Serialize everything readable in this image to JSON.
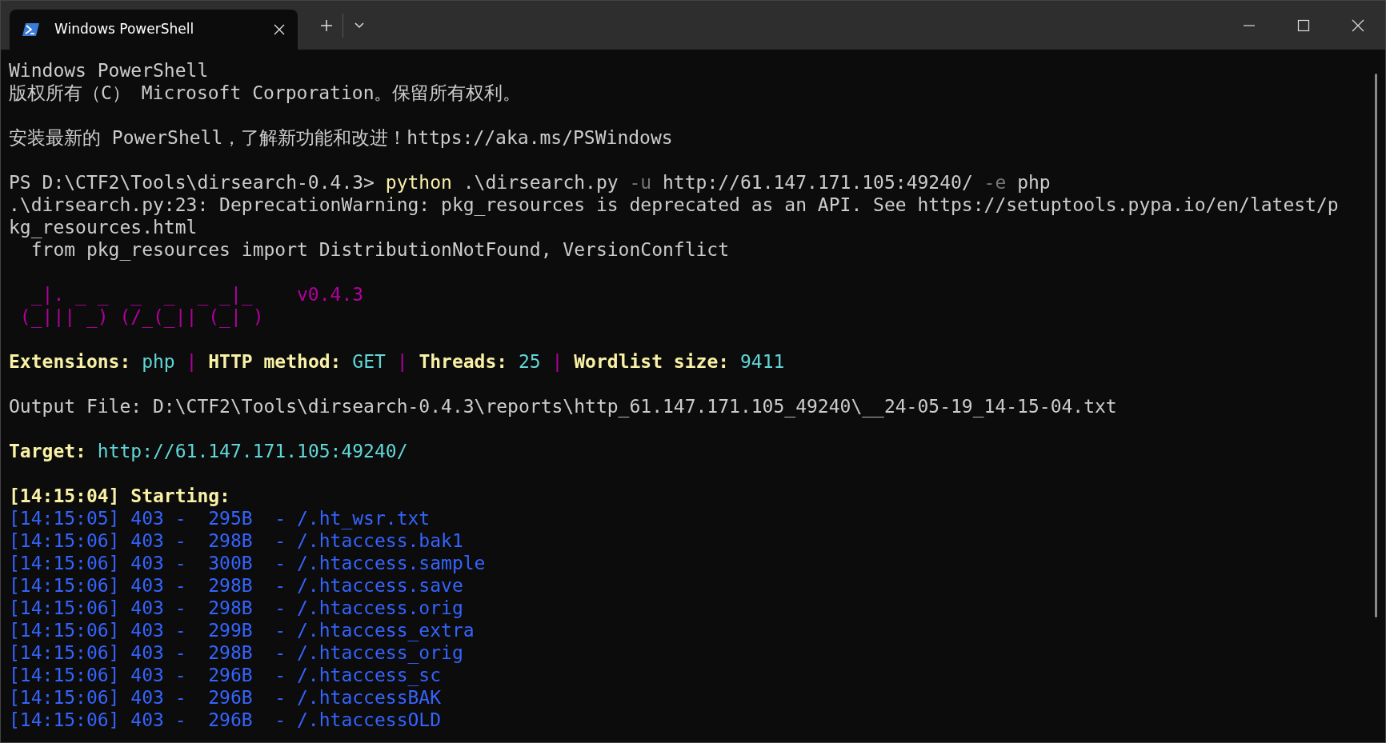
{
  "tabs": [
    {
      "title": "Windows PowerShell",
      "selected": true
    }
  ],
  "blocks": [
    [
      [
        {
          "kind": "plain",
          "text": "Windows PowerShell"
        }
      ],
      [
        {
          "kind": "plain",
          "text": "版权所有（C） Microsoft Corporation。保留所有权利。"
        }
      ]
    ],
    [
      [
        {
          "kind": "plain",
          "text": "安装最新的 PowerShell，了解新功能和改进！https://aka.ms/PSWindows"
        }
      ]
    ],
    [
      [
        {
          "kind": "plain",
          "text": "PS D:\\CTF2\\Tools\\dirsearch-0.4.3> "
        },
        {
          "kind": "command",
          "text": "python"
        },
        {
          "kind": "plain",
          "text": " .\\dirsearch.py "
        },
        {
          "kind": "flag",
          "text": "-u"
        },
        {
          "kind": "plain",
          "text": " http://61.147.171.105:49240/ "
        },
        {
          "kind": "flag",
          "text": "-e"
        },
        {
          "kind": "plain",
          "text": " php"
        }
      ],
      [
        {
          "kind": "plain",
          "text": ".\\dirsearch.py:23: DeprecationWarning: pkg_resources is deprecated as an API. See https://setuptools.pypa.io/en/latest/p"
        }
      ],
      [
        {
          "kind": "plain",
          "text": "kg_resources.html"
        }
      ],
      [
        {
          "kind": "plain",
          "text": "  from pkg_resources import DistributionNotFound, VersionConflict"
        }
      ]
    ],
    [
      [
        {
          "kind": "art",
          "text": "  _|. _ _  _  _  _ _|_    v0.4.3"
        }
      ],
      [
        {
          "kind": "art",
          "text": " (_||| _) (/_(_|| (_| )"
        }
      ]
    ],
    [
      [
        {
          "kind": "label",
          "text": "Extensions: "
        },
        {
          "kind": "value",
          "text": "php"
        },
        {
          "kind": "separator",
          "text": " | "
        },
        {
          "kind": "label",
          "text": "HTTP method: "
        },
        {
          "kind": "value",
          "text": "GET"
        },
        {
          "kind": "separator",
          "text": " | "
        },
        {
          "kind": "label",
          "text": "Threads: "
        },
        {
          "kind": "value",
          "text": "25"
        },
        {
          "kind": "separator",
          "text": " | "
        },
        {
          "kind": "label",
          "text": "Wordlist size: "
        },
        {
          "kind": "value",
          "text": "9411"
        }
      ]
    ],
    [
      [
        {
          "kind": "plain",
          "text": "Output File: D:\\CTF2\\Tools\\dirsearch-0.4.3\\reports\\http_61.147.171.105_49240\\__24-05-19_14-15-04.txt"
        }
      ]
    ],
    [
      [
        {
          "kind": "label",
          "text": "Target: "
        },
        {
          "kind": "value",
          "text": "http://61.147.171.105:49240/"
        }
      ]
    ],
    [
      [
        {
          "kind": "label",
          "text": "[14:15:04] Starting:"
        }
      ],
      [
        {
          "kind": "found",
          "text": "[14:15:05] 403 -  295B  - /.ht_wsr.txt"
        }
      ],
      [
        {
          "kind": "found",
          "text": "[14:15:06] 403 -  298B  - /.htaccess.bak1"
        }
      ],
      [
        {
          "kind": "found",
          "text": "[14:15:06] 403 -  300B  - /.htaccess.sample"
        }
      ],
      [
        {
          "kind": "found",
          "text": "[14:15:06] 403 -  298B  - /.htaccess.save"
        }
      ],
      [
        {
          "kind": "found",
          "text": "[14:15:06] 403 -  298B  - /.htaccess.orig"
        }
      ],
      [
        {
          "kind": "found",
          "text": "[14:15:06] 403 -  299B  - /.htaccess_extra"
        }
      ],
      [
        {
          "kind": "found",
          "text": "[14:15:06] 403 -  298B  - /.htaccess_orig"
        }
      ],
      [
        {
          "kind": "found",
          "text": "[14:15:06] 403 -  296B  - /.htaccess_sc"
        }
      ],
      [
        {
          "kind": "found",
          "text": "[14:15:06] 403 -  296B  - /.htaccessBAK"
        }
      ],
      [
        {
          "kind": "found",
          "text": "[14:15:06] 403 -  296B  - /.htaccessOLD"
        }
      ]
    ]
  ]
}
